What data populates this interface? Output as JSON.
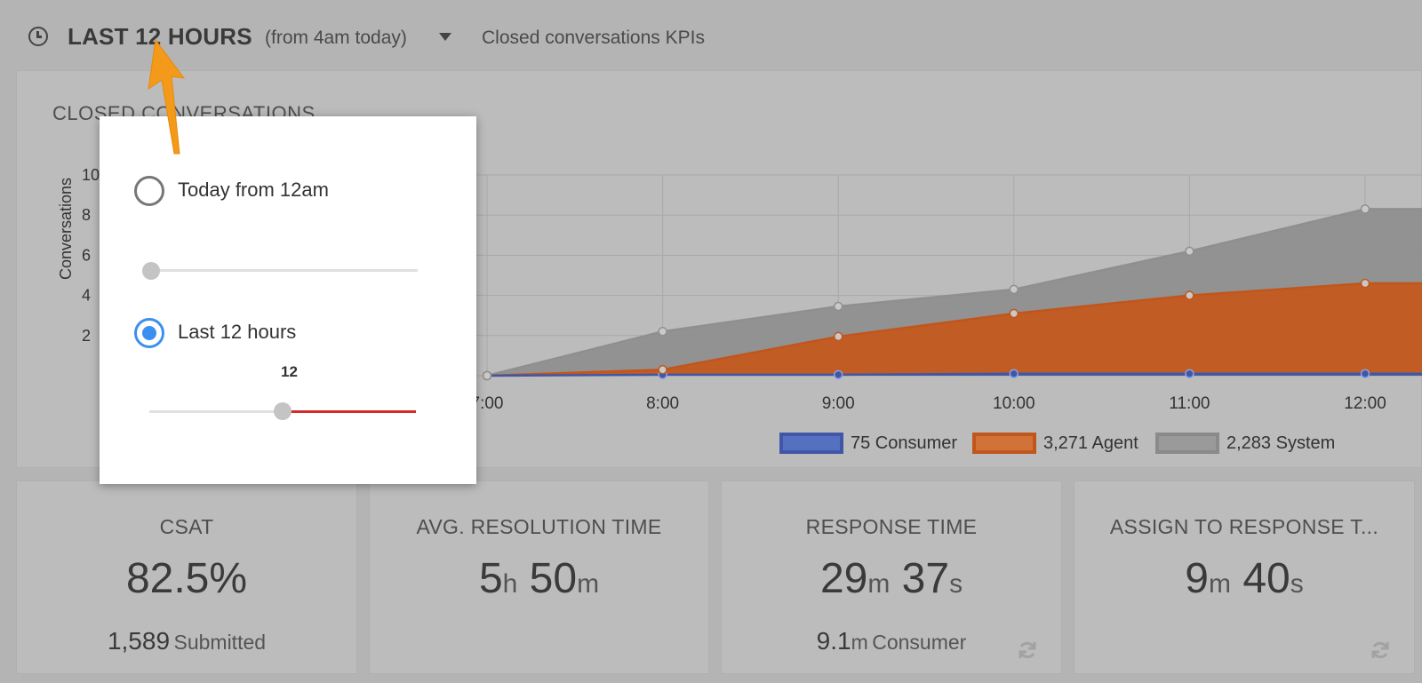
{
  "header": {
    "range_title": "LAST 12 HOURS",
    "range_sub": "(from 4am today)",
    "kpi_link": "Closed conversations KPIs"
  },
  "chart_card": {
    "title": "CLOSED CONVERSATIONS",
    "y_tick_fragments": [
      "10",
      "8",
      "6",
      "4",
      "2"
    ]
  },
  "chart_data": {
    "type": "area",
    "title": "CLOSED CONVERSATIONS",
    "ylabel": "Conversations",
    "xlabel": "",
    "x": [
      "7:00",
      "8:00",
      "9:00",
      "10:00",
      "11:00",
      "12:00"
    ],
    "stacked": true,
    "ylim": [
      0,
      1000
    ],
    "grid": true,
    "legend_position": "bottom",
    "series": [
      {
        "name": "Consumer",
        "total": "75",
        "color": "#3f57a6",
        "values": [
          0,
          5,
          5,
          10,
          10,
          10
        ]
      },
      {
        "name": "Agent",
        "total": "3,271",
        "color": "#c1561c",
        "values": [
          0,
          25,
          190,
          300,
          390,
          450
        ]
      },
      {
        "name": "System",
        "total": "2,283",
        "color": "#8f8f8f",
        "values": [
          0,
          190,
          150,
          120,
          220,
          370
        ]
      }
    ]
  },
  "legend": [
    {
      "label": "75 Consumer"
    },
    {
      "label": "3,271 Agent"
    },
    {
      "label": "2,283 System"
    }
  ],
  "kpis": [
    {
      "title": "CSAT",
      "value": "82.5%",
      "foot_num": "1,589",
      "foot_label": "Submitted"
    },
    {
      "title": "AVG. RESOLUTION TIME",
      "v1": "5",
      "u1": "h",
      "v2": "50",
      "u2": "m"
    },
    {
      "title": "RESPONSE TIME",
      "v1": "29",
      "u1": "m",
      "v2": "37",
      "u2": "s",
      "foot_num": "9.1",
      "foot_unit": "m",
      "foot_label": "Consumer"
    },
    {
      "title": "ASSIGN TO RESPONSE T...",
      "v1": "9",
      "u1": "m",
      "v2": "40",
      "u2": "s"
    }
  ],
  "dropdown": {
    "option_today": "Today from 12am",
    "option_last": "Last 12 hours",
    "slider_value": "12",
    "today_selected": false,
    "last_selected": true,
    "slider_fraction": 0.5
  },
  "colors": {
    "consumer": "#3f57a6",
    "agent": "#c1561c",
    "system": "#8f8f8f",
    "radio_active": "#3b8ff0",
    "slider_active": "#d42a2a",
    "arrow": "#f39a1a"
  },
  "icons": [
    "clock-icon",
    "caret-down-icon",
    "refresh-icon",
    "pointer-arrow-icon"
  ]
}
